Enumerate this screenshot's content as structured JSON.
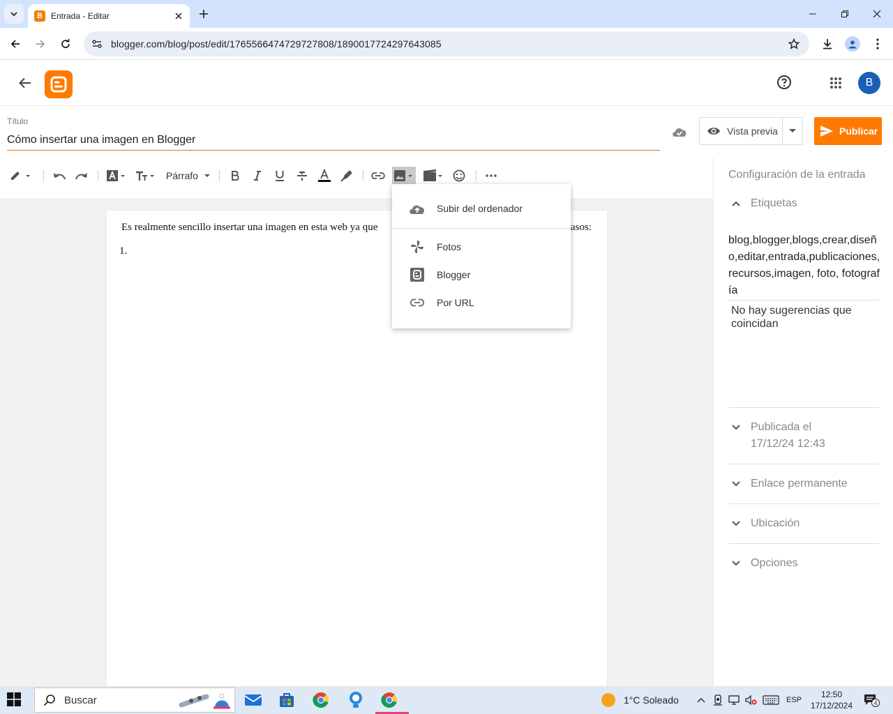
{
  "browser": {
    "tab_title": "Entrada - Editar",
    "favicon_letter": "B",
    "url": "blogger.com/blog/post/edit/1765566474729727808/1890017724297643085"
  },
  "header": {
    "avatar_letter": "B"
  },
  "post": {
    "title_label": "Título",
    "title_value": "Cómo insertar una imagen en Blogger",
    "preview_label": "Vista previa",
    "publish_label": "Publicar"
  },
  "toolbar": {
    "paragraph_label": "Párrafo"
  },
  "editor": {
    "body_text": "Es realmente sencillo insertar una imagen en esta web ya que",
    "body_text_end": "asos:",
    "list_item_1": "1."
  },
  "image_menu": {
    "items": [
      {
        "label": "Subir del ordenador",
        "icon": "cloud-upload-icon"
      },
      {
        "label": "Fotos",
        "icon": "google-photos-icon"
      },
      {
        "label": "Blogger",
        "icon": "blogger-icon"
      },
      {
        "label": "Por URL",
        "icon": "link-icon"
      }
    ]
  },
  "sidebar": {
    "title": "Configuración de la entrada",
    "labels_section": "Etiquetas",
    "tags_value": "blog,blogger,blogs,crear,diseño,editar,entrada,publicaciones,recursos,imagen, foto, fotografía",
    "no_suggestions": "No hay sugerencias que coincidan",
    "published_label": "Publicada el",
    "published_date": "17/12/24 12:43",
    "permalink": "Enlace permanente",
    "location": "Ubicación",
    "options": "Opciones"
  },
  "taskbar": {
    "search_label": "Buscar",
    "weather": "1°C  Soleado",
    "language": "ESP",
    "time": "12:50",
    "date": "17/12/2024",
    "notifications_count": "4"
  },
  "colors": {
    "accent": "#ff7a00",
    "tabstrip": "#d3e3fd",
    "avatar": "#1a5fb4"
  }
}
